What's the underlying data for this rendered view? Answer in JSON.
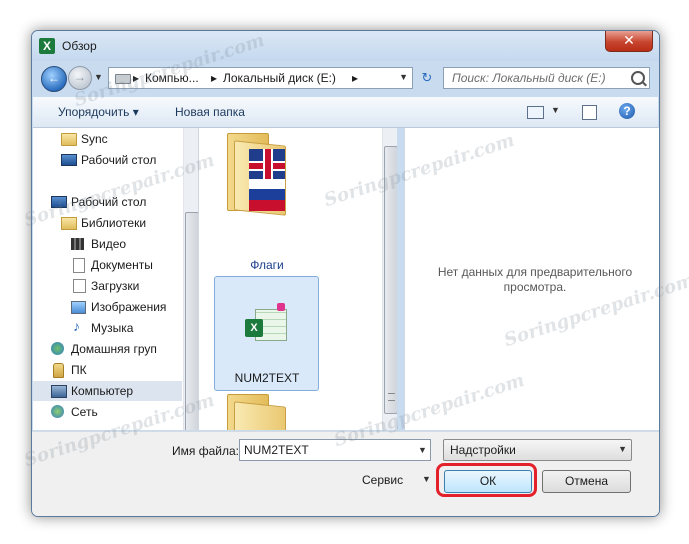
{
  "window": {
    "title": "Обзор",
    "close_glyph": "✕"
  },
  "navbar": {
    "back_glyph": "←",
    "forward_glyph": "→",
    "breadcrumb": [
      "Компью...",
      "Локальный диск (E:)"
    ],
    "search_placeholder": "Поиск: Локальный диск (E:)",
    "refresh_glyph": "↻"
  },
  "toolbar": {
    "organize_label": "Упорядочить ▾",
    "new_folder_label": "Новая папка",
    "help_glyph": "?"
  },
  "sidebar": {
    "items": [
      {
        "label": "Sync",
        "icon": "folder-icon"
      },
      {
        "label": "Рабочий стол",
        "icon": "desktop-icon"
      },
      {
        "label": "Рабочий стол",
        "icon": "desktop-icon"
      },
      {
        "label": "Библиотеки",
        "icon": "libraries-icon"
      },
      {
        "label": "Видео",
        "icon": "video-icon"
      },
      {
        "label": "Документы",
        "icon": "documents-icon"
      },
      {
        "label": "Загрузки",
        "icon": "downloads-icon"
      },
      {
        "label": "Изображения",
        "icon": "pictures-icon"
      },
      {
        "label": "Музыка",
        "icon": "music-icon"
      },
      {
        "label": "Домашняя груп",
        "icon": "homegroup-icon"
      },
      {
        "label": "ПК",
        "icon": "user-icon"
      },
      {
        "label": "Компьютер",
        "icon": "computer-icon"
      },
      {
        "label": "Сеть",
        "icon": "network-icon"
      }
    ]
  },
  "files": {
    "items": [
      {
        "label": "Флаги",
        "type": "folder"
      },
      {
        "label": "NUM2TEXT",
        "type": "excel-addin"
      }
    ]
  },
  "preview": {
    "line1": "Нет данных для предварительного",
    "line2": "просмотра."
  },
  "bottom": {
    "filename_label": "Имя файла:",
    "filename_value": "NUM2TEXT",
    "filter_value": "Надстройки",
    "service_label": "Сервис",
    "ok_label": "ОК",
    "cancel_label": "Отмена"
  },
  "watermark": "Soringpcrepair.com",
  "colors": {
    "highlight_border": "#e3212b",
    "accent": "#3c7fb1"
  }
}
